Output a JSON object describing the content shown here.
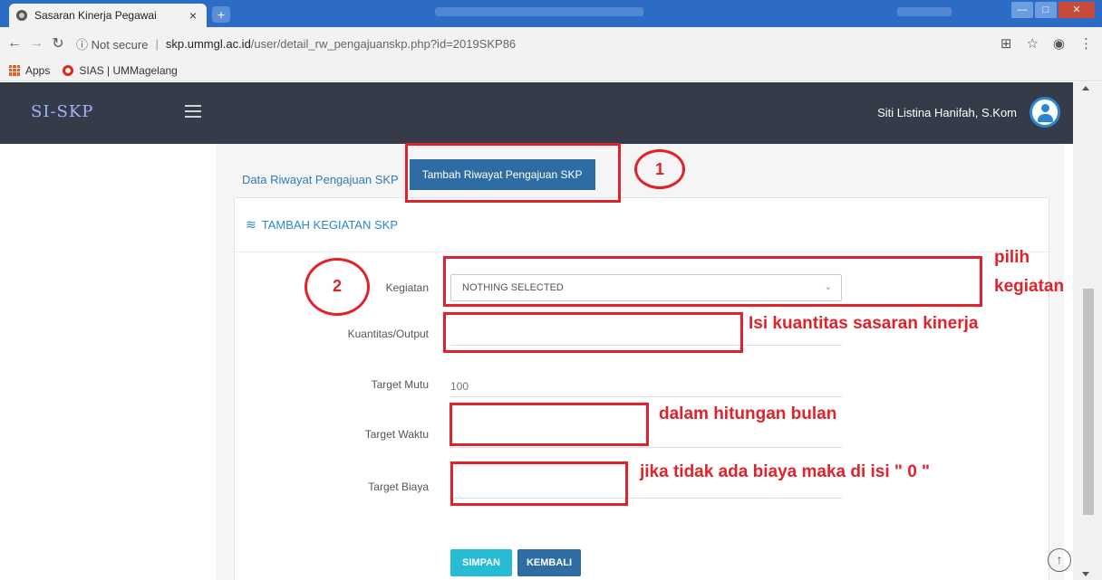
{
  "browser": {
    "tab_title": "Sasaran Kinerja Pegawai",
    "tab_close": "×",
    "new_tab": "+",
    "insecure_label": "ⓘ Not secure",
    "url_host": "skp.ummgl.ac.id",
    "url_path": "/user/detail_rw_pengajuanskp.php?id=2019SKP86",
    "bookmarks": [
      {
        "label": "Apps",
        "icon": "apps-icon"
      },
      {
        "label": "SIAS | UMMagelang",
        "icon": "sias-icon"
      }
    ]
  },
  "app": {
    "logo": "SI-SKP",
    "user_name": "Siti Listina Hanifah, S.Kom"
  },
  "tabs": {
    "history_link": "Data Riwayat Pengajuan SKP",
    "add_button": "Tambah Riwayat Pengajuan SKP"
  },
  "card": {
    "title": "TAMBAH KEGIATAN SKP"
  },
  "form": {
    "kegiatan_label": "Kegiatan",
    "kegiatan_value": "NOTHING SELECTED",
    "kuantitas_label": "Kuantitas/Output",
    "target_mutu_label": "Target Mutu",
    "target_mutu_value": "100",
    "target_waktu_label": "Target Waktu",
    "target_biaya_label": "Target Biaya",
    "save_button": "SIMPAN",
    "back_button": "KEMBALI"
  },
  "annotations": {
    "step1": "1",
    "step2": "2",
    "pilih": "pilih",
    "kegiatan": "kegiatan",
    "kuantitas_note": "Isi kuantitas sasaran kinerja",
    "waktu_note": "dalam hitungan bulan",
    "biaya_note": "jika tidak ada biaya maka di isi \" 0 \""
  },
  "colors": {
    "annotation_red": "#e0232a",
    "nav_dark": "#353b48",
    "primary_blue": "#2e6da4",
    "info_cyan": "#26bcd6"
  }
}
